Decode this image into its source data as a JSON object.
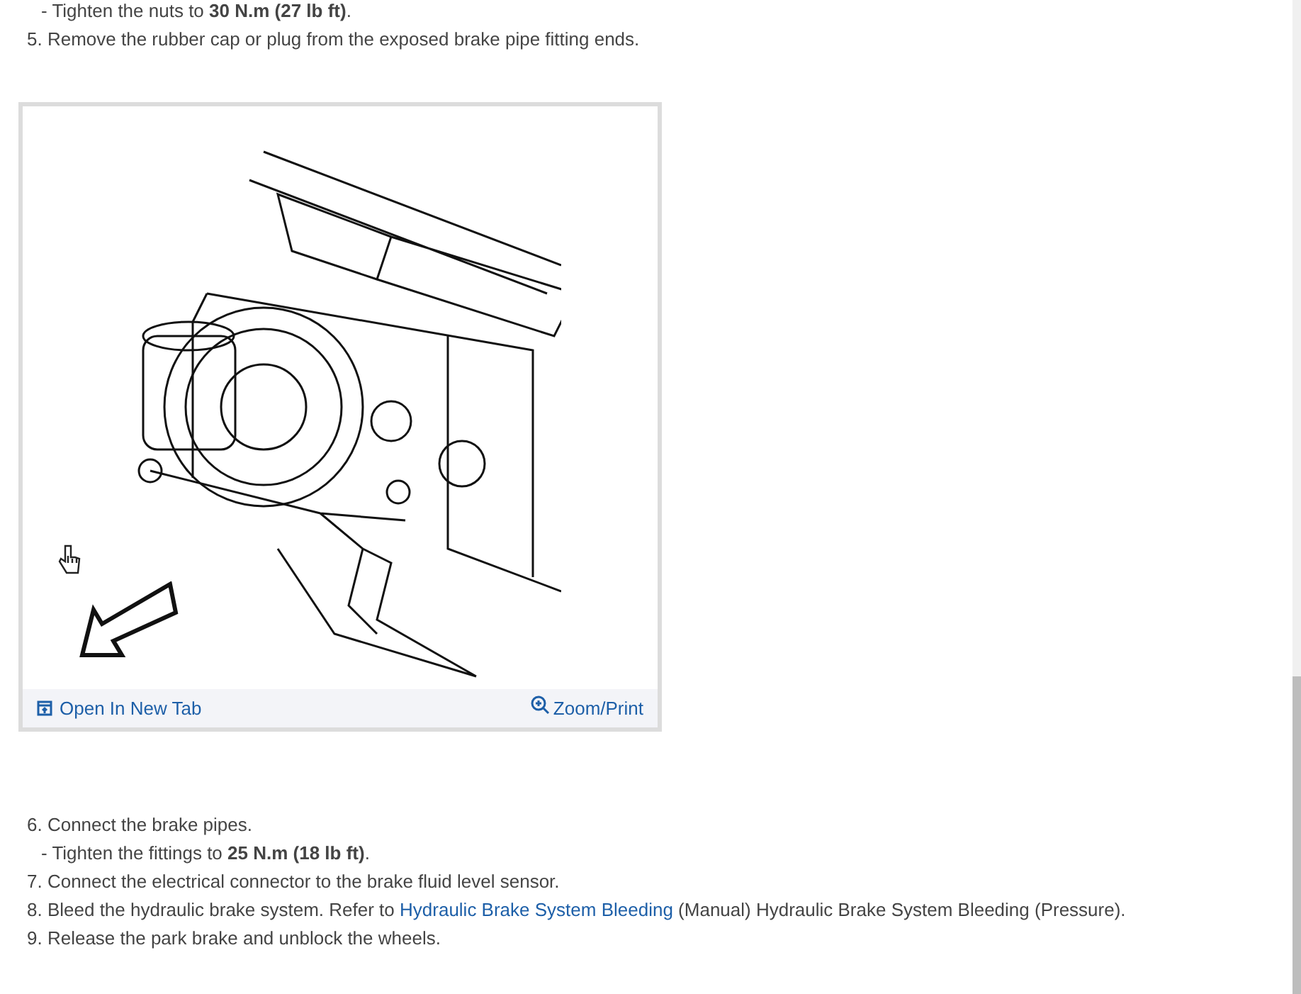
{
  "steps_before": [
    {
      "kind": "sub",
      "text": "- Tighten the nuts to **30 N.m (27 lb ft)**."
    },
    {
      "kind": "step",
      "text": "5. Remove the rubber cap or plug from the exposed brake pipe fitting ends."
    }
  ],
  "figure": {
    "open_link": "Open In New Tab",
    "zoom_link": "Zoom/Print"
  },
  "steps_after": [
    {
      "kind": "step",
      "text": "6. Connect the brake pipes."
    },
    {
      "kind": "sub",
      "text": "- Tighten the fittings to **25 N.m (18 lb ft)**."
    },
    {
      "kind": "step",
      "text": "7. Connect the electrical connector to the brake fluid level sensor."
    },
    {
      "kind": "step",
      "text": "8. Bleed the hydraulic brake system. Refer to ",
      "link": "Hydraulic Brake System Bleeding",
      "after": " (Manual) Hydraulic Brake System Bleeding (Pressure)."
    },
    {
      "kind": "step",
      "text": "9. Release the park brake and unblock the wheels."
    }
  ]
}
